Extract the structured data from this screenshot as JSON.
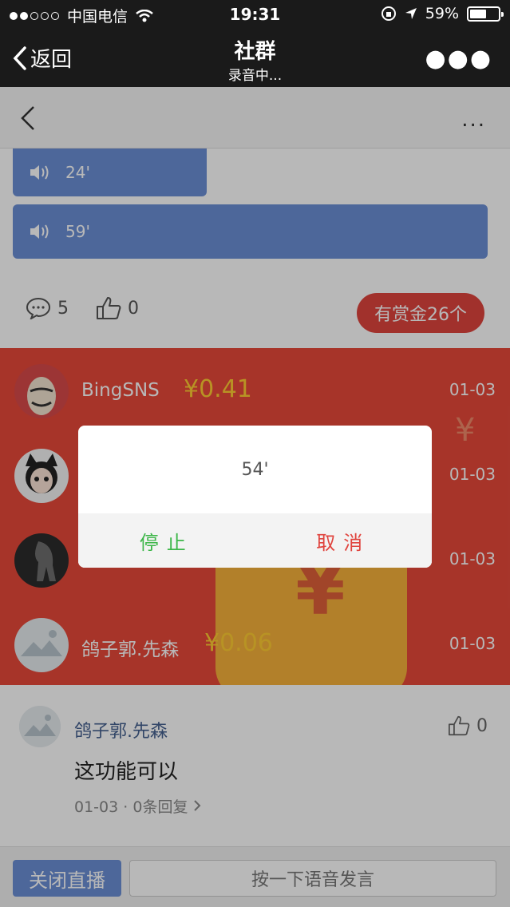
{
  "status_bar": {
    "carrier": "中国电信",
    "time": "19:31",
    "battery": "59%",
    "battery_level": 0.59
  },
  "nav": {
    "back_label": "返回",
    "title": "社群",
    "subtitle": "录音中..."
  },
  "subbar": {
    "more": "..."
  },
  "voice_messages": [
    {
      "duration": "24'"
    },
    {
      "duration": "59'"
    }
  ],
  "post_actions": {
    "comment_count": "5",
    "like_count": "0",
    "reward_button": "有赏金26个"
  },
  "rewards": [
    {
      "name": "BingSNS",
      "amount": "¥0.41",
      "date": "01-03"
    },
    {
      "name": "",
      "amount": "",
      "date": "01-03"
    },
    {
      "name": "",
      "amount": "",
      "date": "01-03"
    },
    {
      "name": "鸽子郭.先森",
      "amount": "¥0.06",
      "date": "01-03"
    }
  ],
  "comment": {
    "name": "鸽子郭.先森",
    "likes": "0",
    "text": "这功能可以",
    "date": "01-03",
    "replies": "0条回复"
  },
  "bottom_bar": {
    "close_live": "关闭直播",
    "voice_button": "按一下语音发言"
  },
  "dialog": {
    "duration": "54'",
    "stop": "停止",
    "cancel": "取消"
  },
  "colors": {
    "voice_bubble": "#6b8fd6",
    "reward_panel": "#e8493a",
    "reward_amount": "#ffcc33",
    "stop": "#3cb648",
    "cancel": "#e0443e"
  }
}
